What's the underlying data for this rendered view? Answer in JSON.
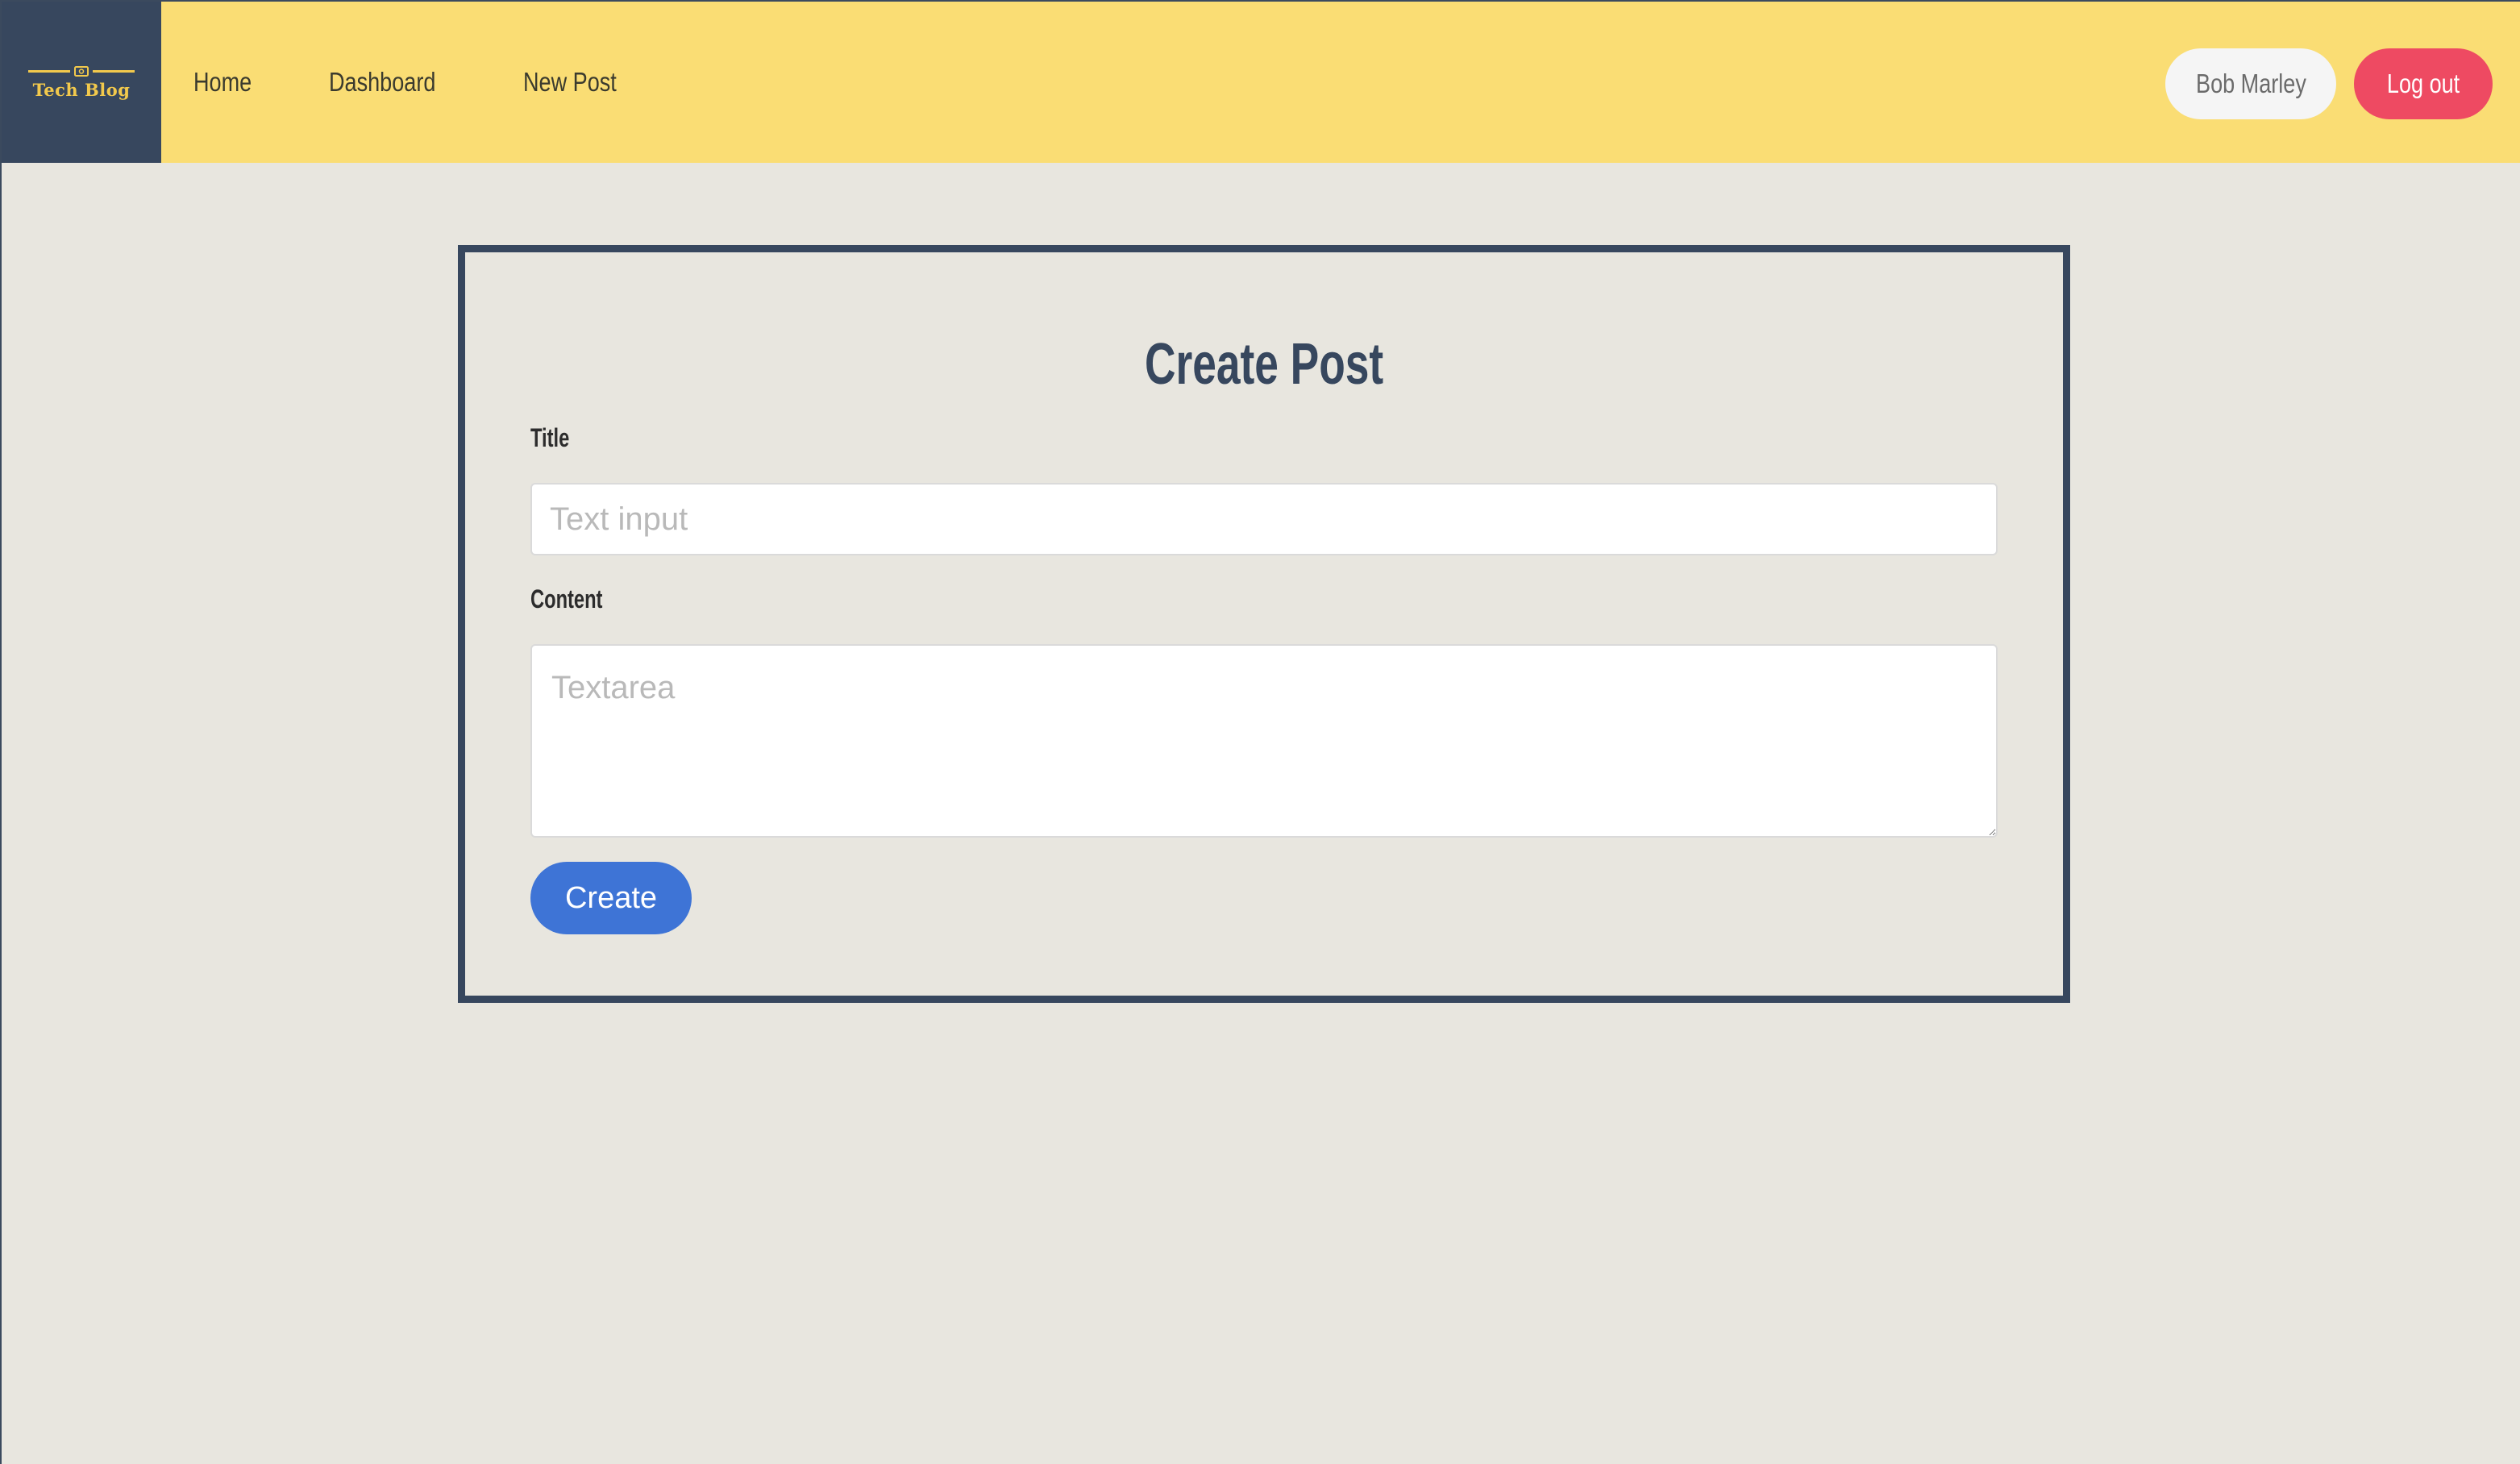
{
  "navbar": {
    "brand": {
      "label": "Tech Blog",
      "icon": "laptop-icon",
      "colors": {
        "background": "#37475e",
        "accent": "#f2c94c"
      }
    },
    "background": "#fadd74",
    "links": [
      {
        "label": "Home"
      },
      {
        "label": "Dashboard"
      },
      {
        "label": "New Post"
      }
    ],
    "user_label": "Bob Marley",
    "logout_label": "Log out",
    "logout_color": "#ee4a62"
  },
  "form": {
    "title": "Create Post",
    "title_field": {
      "label": "Title",
      "placeholder": "Text input",
      "value": ""
    },
    "content_field": {
      "label": "Content",
      "placeholder": "Textarea",
      "value": ""
    },
    "submit_label": "Create",
    "submit_color": "#3e74d6"
  }
}
